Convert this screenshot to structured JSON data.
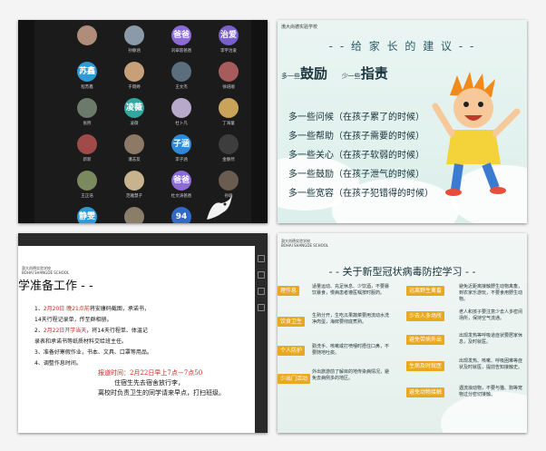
{
  "gallery": {
    "tiles": [
      {
        "col": 0,
        "row": 0,
        "avatar": "",
        "name": "",
        "color": "#b08d7a"
      },
      {
        "col": 1,
        "row": 0,
        "avatar": "",
        "name": "孙静涵",
        "color": "#8a9aa8"
      },
      {
        "col": 2,
        "row": 0,
        "avatar": "爸爸",
        "name": "刘翠容爸爸",
        "color": "#8c6bd6"
      },
      {
        "col": 3,
        "row": 0,
        "avatar": "治爱",
        "name": "李宇治爱",
        "color": "#7a5fcf"
      },
      {
        "col": 0,
        "row": 1,
        "avatar": "苏鑫",
        "name": "程苏鑫",
        "color": "#2f9ad6"
      },
      {
        "col": 1,
        "row": 1,
        "avatar": "",
        "name": "于雨婷",
        "color": "#c7a07a"
      },
      {
        "col": 2,
        "row": 1,
        "avatar": "",
        "name": "王文杰",
        "color": "#5a6e7e"
      },
      {
        "col": 3,
        "row": 1,
        "avatar": "",
        "name": "徐培顺",
        "color": "#a85b5b"
      },
      {
        "col": 0,
        "row": 2,
        "avatar": "",
        "name": "张煦",
        "color": "#6b7a6a"
      },
      {
        "col": 1,
        "row": 2,
        "avatar": "凌薇",
        "name": "凌薇",
        "color": "#2fa8a0"
      },
      {
        "col": 2,
        "row": 2,
        "avatar": "",
        "name": "杜卜凡",
        "color": "#b7a9c9"
      },
      {
        "col": 3,
        "row": 2,
        "avatar": "",
        "name": "丁海童",
        "color": "#c9a35a"
      },
      {
        "col": 0,
        "row": 3,
        "avatar": "",
        "name": "新新",
        "color": "#a04a4a"
      },
      {
        "col": 1,
        "row": 3,
        "avatar": "",
        "name": "潘志友",
        "color": "#8d7a66"
      },
      {
        "col": 2,
        "row": 3,
        "avatar": "子涵",
        "name": "李子涵",
        "color": "#2f8ad6"
      },
      {
        "col": 3,
        "row": 3,
        "avatar": "",
        "name": "金静然",
        "color": "#3d3d3d"
      },
      {
        "col": 0,
        "row": 4,
        "avatar": "",
        "name": "王正浩",
        "color": "#7b8a5e"
      },
      {
        "col": 1,
        "row": 4,
        "avatar": "",
        "name": "范雅慧子",
        "color": "#c7b38d"
      },
      {
        "col": 2,
        "row": 4,
        "avatar": "爸爸",
        "name": "杜文涛爸爸",
        "color": "#8c6bd6"
      },
      {
        "col": 3,
        "row": 4,
        "avatar": "",
        "name": "孙瑜",
        "color": "#6a5d4f"
      },
      {
        "col": 0,
        "row": 5,
        "avatar": "静雯",
        "name": "",
        "color": "#2f9ad6"
      },
      {
        "col": 1,
        "row": 5,
        "avatar": "",
        "name": "",
        "color": "#8a7d6a"
      },
      {
        "col": 2,
        "row": 5,
        "avatar": "94",
        "name": "",
        "color": "#2f6ac6"
      }
    ]
  },
  "advice": {
    "school": "渤大尚德实验学校",
    "title": "- - 给 家 长 的 建 议 - -",
    "head_left_prefix": "多一些",
    "head_left": "鼓励",
    "head_right_prefix": "少一些",
    "head_right": "指责",
    "items": [
      "多一些问候（在孩子累了的时候）",
      "多一些帮助（在孩子需要的时候）",
      "多一些关心（在孩子软弱的时候）",
      "多一些鼓励（在孩子泄气的时候）",
      "多一些宽容（在孩子犯错得的时候）"
    ]
  },
  "prep": {
    "school": "渤大尚德实验学校",
    "school_en": "BOHAI SHANGDE SCHOOL",
    "title": "学准备工作 - -",
    "line1_red": "2月20日 晚21点前",
    "line1_rest": "将安康码截图，承诺书，",
    "line2": "14天行程记录单，传至群相册。",
    "line3_red": "2月22日开学当天",
    "line3_rest": "，将14天行程单、体温记",
    "line4": "录表和承诺书等纸质材料交给班主任。",
    "line5": "3、准备好寒假作业，书本、文具、口罩等用品。",
    "line6": "4、调整作息时间。",
    "notice_red": "报道时间：2月22日早上7点－7点50",
    "notice_2": "住宿生先去宿舍放行李，",
    "notice_3": "离校时负责卫生的同学请来早点，打扫班级。"
  },
  "prevention": {
    "school": "渤大尚德实验学校",
    "school_en": "BOHAI SHANGDE SCHOOL",
    "title": "- - 关于新型冠状病毒防控学习 - -",
    "left_tags": [
      "理作息",
      "饮食卫生",
      "个人防护",
      "少出门活动"
    ],
    "left_desc": [
      "适量运动、充足休息、少饮酒，不要暴饮暴食，慢病患者遵医嘱按时服药。",
      "生熟分开，生吃瓜果蔬菜要用流动水洗净肉蛋，海鲜要彻底煮熟。",
      "勤洗手、咳嗽或打喷嚏时捂住口鼻，不要随地吐痰。",
      "外出旅游前了解目的地传染病情况，避免去病例多的地区。"
    ],
    "right_tags": [
      "远离野生禽畜",
      "少去人多场所",
      "避免带病外出",
      "生病及时就医",
      "避免动物接触"
    ],
    "right_desc": [
      "避免近距离接触野生动物禽畜，到农家乐游玩，不要食用野生动物。",
      "老人和孩子要注意少去人多密闭场所，保持空气流通。",
      "出现发热等呼吸道症状要居家休息，及时就医。",
      "出现发热、咳嗽、呼吸困难等症状及时就医，提前告知接触史。",
      "遇流浪动物，不要与猫、狗等宠物过分密切接触。"
    ]
  }
}
